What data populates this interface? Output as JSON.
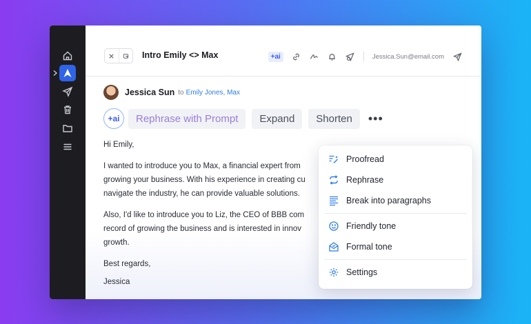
{
  "thread": {
    "title": "Intro Emily <> Max"
  },
  "header": {
    "ai_label": "+ai",
    "user_email": "Jessica.Sun@email.com"
  },
  "sender": {
    "name": "Jessica Sun",
    "to_label": "to",
    "recipients": "Emily Jones, Max"
  },
  "ai_toolbar": {
    "ai_button": "+ai",
    "rephrase_prompt": "Rephrase with Prompt",
    "expand": "Expand",
    "shorten": "Shorten",
    "more": "•••"
  },
  "email": {
    "greeting": "Hi Emily,",
    "paragraph1": "I wanted to introduce you to Max, a financial expert from\ngrowing your business. With his experience in creating cu\nnavigate the industry, he can provide valuable solutions.",
    "paragraph2": "Also, I'd like to introduce you to Liz, the CEO of BBB com\nrecord of growing the business and is interested in innov\ngrowth.",
    "closing": "Best regards,",
    "signature": "Jessica"
  },
  "ai_menu": {
    "items": [
      {
        "label": "Proofread",
        "icon": "proofread-icon"
      },
      {
        "label": "Rephrase",
        "icon": "rephrase-icon"
      },
      {
        "label": "Break into paragraphs",
        "icon": "paragraphs-icon"
      },
      {
        "label": "Friendly tone",
        "icon": "smile-icon"
      },
      {
        "label": "Formal tone",
        "icon": "envelope-icon"
      },
      {
        "label": "Settings",
        "icon": "gear-icon"
      }
    ]
  },
  "colors": {
    "accent": "#2f63e8",
    "link": "#2f7ee6",
    "menu_icon": "#2f7ee6",
    "rail": "#1d1d21"
  }
}
